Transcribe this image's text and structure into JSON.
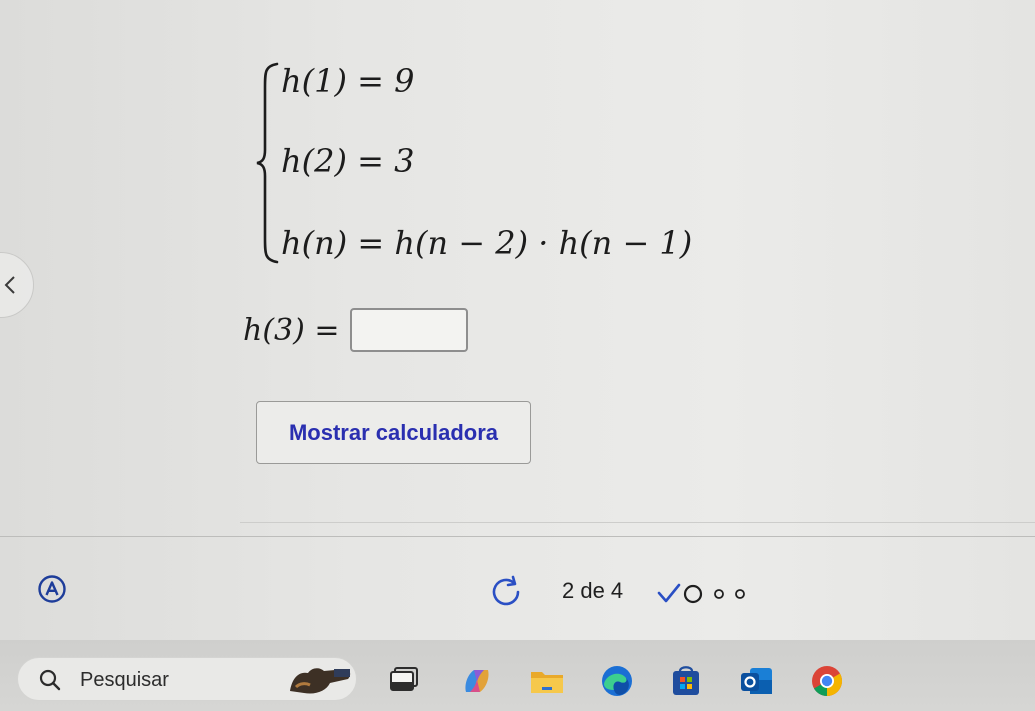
{
  "system": {
    "eq1": "h(1) = 9",
    "eq2": "h(2) = 3",
    "eq3": "h(n) = h(n − 2) · h(n − 1)"
  },
  "answer": {
    "label": "h(3) =",
    "value": ""
  },
  "calculator_button": {
    "label": "Mostrar calculadora"
  },
  "progress": {
    "counter": "2 de 4",
    "current": 2,
    "total": 4
  },
  "taskbar": {
    "search_label": "Pesquisar",
    "apps": [
      "task-view-icon",
      "copilot-icon",
      "file-explorer-icon",
      "edge-icon",
      "store-icon",
      "outlook-icon",
      "chrome-icon"
    ]
  },
  "colors": {
    "accent": "#2a2fb0",
    "checkmark": "#2a4fc4"
  }
}
